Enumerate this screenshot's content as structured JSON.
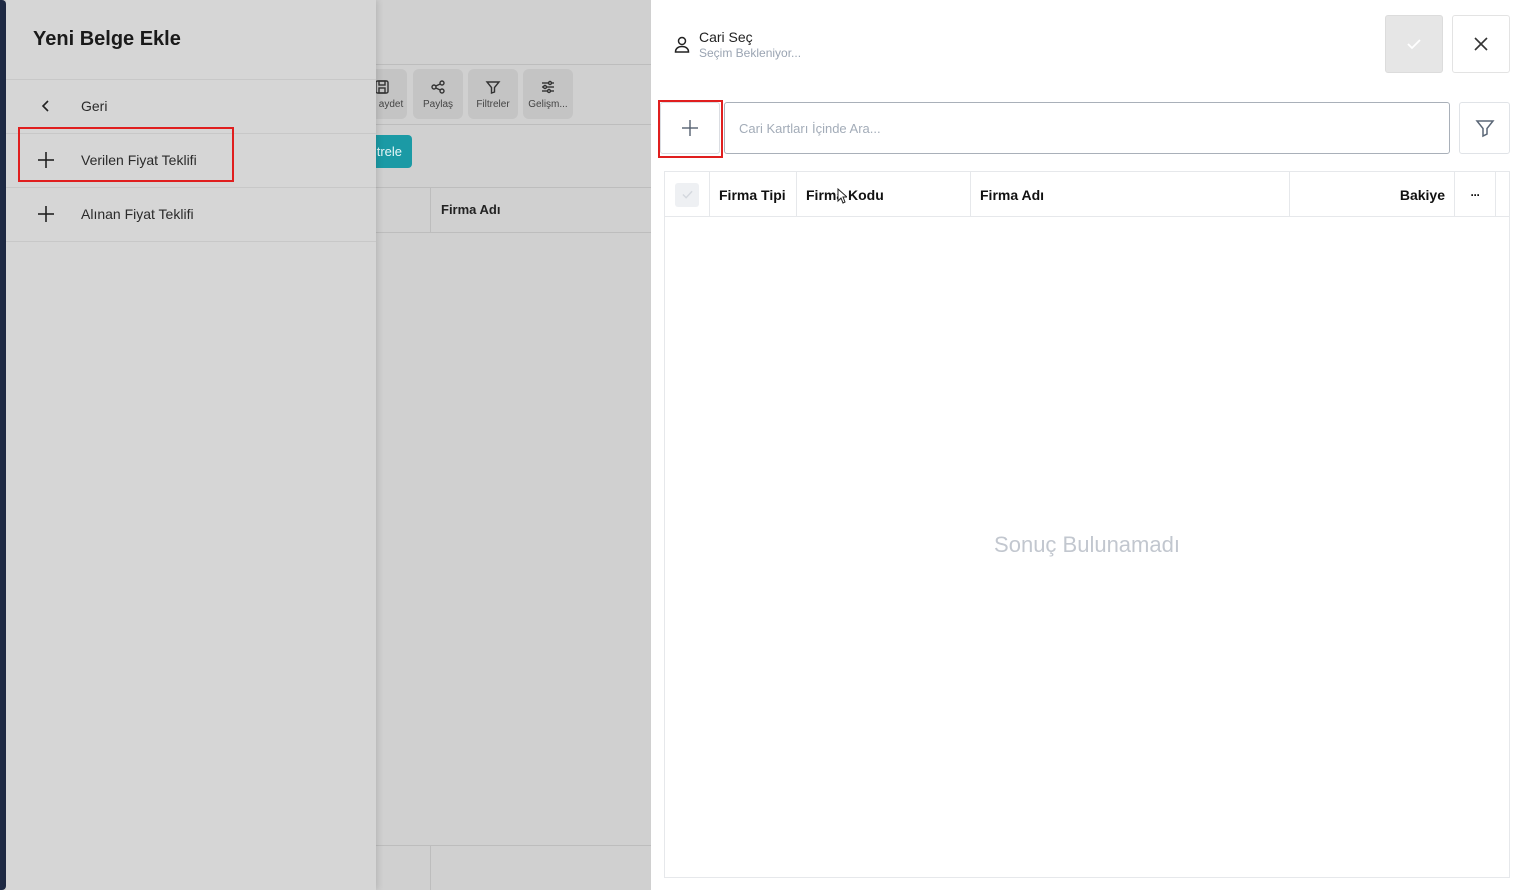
{
  "background": {
    "toolbar": [
      {
        "label": "aydet",
        "icon": "save-icon"
      },
      {
        "label": "Paylaş",
        "icon": "share-icon"
      },
      {
        "label": "Filtreler",
        "icon": "filter-icon"
      },
      {
        "label": "Gelişm...",
        "icon": "sliders-icon"
      }
    ],
    "filter_button_label": "trele",
    "table_column": "Firma Adı",
    "accent": "#1b9aa5"
  },
  "drawer": {
    "title": "Yeni Belge Ekle",
    "items": [
      {
        "label": "Geri",
        "icon": "chevron-left-icon"
      },
      {
        "label": "Verilen Fiyat Teklifi",
        "icon": "plus-icon"
      },
      {
        "label": "Alınan Fiyat Teklifi",
        "icon": "plus-icon"
      }
    ]
  },
  "panel": {
    "title": "Cari Seç",
    "subtitle": "Seçim Bekleniyor...",
    "search": {
      "placeholder": "Cari Kartları İçinde Ara...",
      "value": ""
    },
    "columns": [
      "Firma Tipi",
      "Firma Kodu",
      "Firma Adı",
      "Bakiye",
      "···"
    ],
    "empty_message": "Sonuç Bulunamadı"
  },
  "highlight_color": "#e01e1e"
}
